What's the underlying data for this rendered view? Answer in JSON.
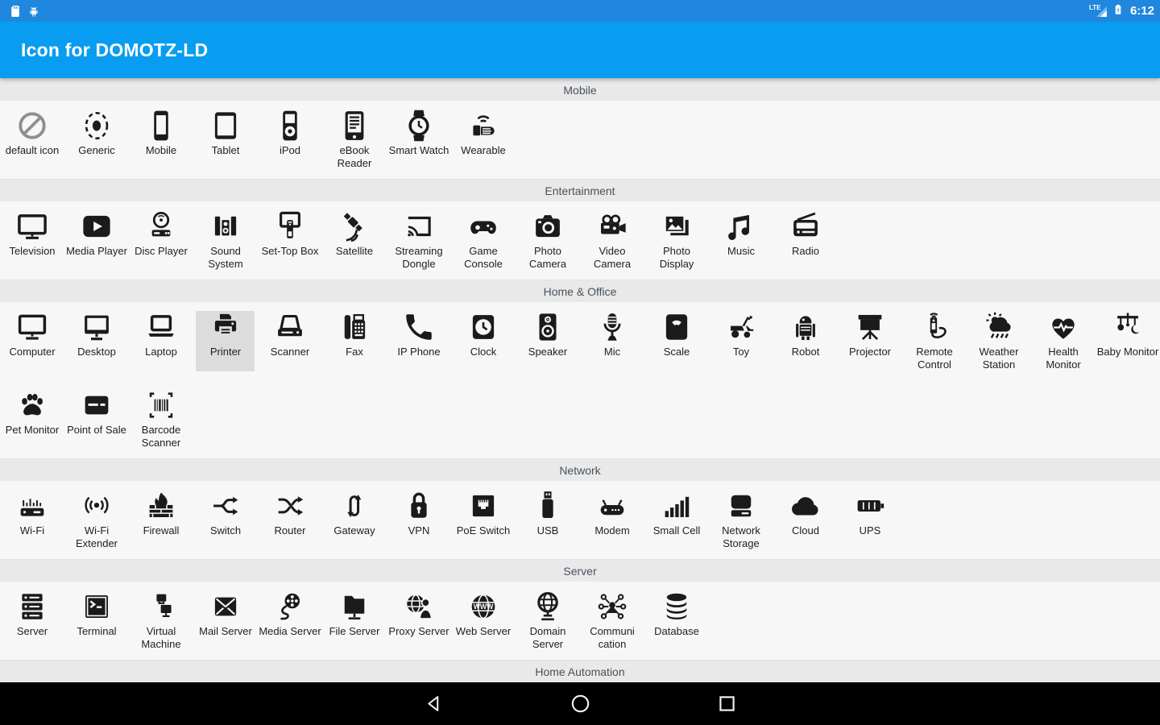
{
  "status_bar": {
    "time": "6:12",
    "network_label": "LTE",
    "left_icons": [
      "sd-card-icon",
      "android-icon"
    ],
    "right_icons": [
      "signal-icon",
      "battery-charging-icon"
    ]
  },
  "app_bar": {
    "title": "Icon for DOMOTZ-LD"
  },
  "colors": {
    "status_bar_bg": "#1f87dd",
    "app_bar_bg": "#089df0",
    "content_bg": "#f7f7f7",
    "section_header_bg": "#e9e9e9",
    "selected_cell_bg": "#dcdcdc",
    "nav_bar_bg": "#000000",
    "icon_color": "#1b1b1b"
  },
  "selection": {
    "section": "Home & Office",
    "label": "Printer"
  },
  "sections": [
    {
      "title": "Mobile",
      "items": [
        {
          "label": "default icon",
          "icon": "default",
          "muted": true
        },
        {
          "label": "Generic",
          "icon": "generic"
        },
        {
          "label": "Mobile",
          "icon": "mobile"
        },
        {
          "label": "Tablet",
          "icon": "tablet"
        },
        {
          "label": "iPod",
          "icon": "ipod"
        },
        {
          "label": "eBook Reader",
          "icon": "ebook-reader"
        },
        {
          "label": "Smart Watch",
          "icon": "smart-watch"
        },
        {
          "label": "Wearable",
          "icon": "wearable"
        }
      ]
    },
    {
      "title": "Entertainment",
      "items": [
        {
          "label": "Television",
          "icon": "television"
        },
        {
          "label": "Media Player",
          "icon": "media-player"
        },
        {
          "label": "Disc Player",
          "icon": "disc-player"
        },
        {
          "label": "Sound System",
          "icon": "sound-system"
        },
        {
          "label": "Set-Top Box",
          "icon": "set-top-box"
        },
        {
          "label": "Satellite",
          "icon": "satellite"
        },
        {
          "label": "Streaming Dongle",
          "icon": "streaming-dongle"
        },
        {
          "label": "Game Console",
          "icon": "game-console"
        },
        {
          "label": "Photo Camera",
          "icon": "photo-camera"
        },
        {
          "label": "Video Camera",
          "icon": "video-camera"
        },
        {
          "label": "Photo Display",
          "icon": "photo-display"
        },
        {
          "label": "Music",
          "icon": "music"
        },
        {
          "label": "Radio",
          "icon": "radio"
        }
      ]
    },
    {
      "title": "Home & Office",
      "items": [
        {
          "label": "Computer",
          "icon": "computer"
        },
        {
          "label": "Desktop",
          "icon": "desktop"
        },
        {
          "label": "Laptop",
          "icon": "laptop"
        },
        {
          "label": "Printer",
          "icon": "printer",
          "selected": true
        },
        {
          "label": "Scanner",
          "icon": "scanner"
        },
        {
          "label": "Fax",
          "icon": "fax"
        },
        {
          "label": "IP Phone",
          "icon": "ip-phone"
        },
        {
          "label": "Clock",
          "icon": "clock"
        },
        {
          "label": "Speaker",
          "icon": "speaker"
        },
        {
          "label": "Mic",
          "icon": "mic"
        },
        {
          "label": "Scale",
          "icon": "scale"
        },
        {
          "label": "Toy",
          "icon": "toy"
        },
        {
          "label": "Robot",
          "icon": "robot"
        },
        {
          "label": "Projector",
          "icon": "projector"
        },
        {
          "label": "Remote Control",
          "icon": "remote-control"
        },
        {
          "label": "Weather Station",
          "icon": "weather-station"
        },
        {
          "label": "Health Monitor",
          "icon": "health-monitor"
        },
        {
          "label": "Baby Monitor",
          "icon": "baby-monitor"
        },
        {
          "label": "Pet Monitor",
          "icon": "pet-monitor"
        },
        {
          "label": "Point of Sale",
          "icon": "point-of-sale"
        },
        {
          "label": "Barcode Scanner",
          "icon": "barcode-scanner"
        }
      ]
    },
    {
      "title": "Network",
      "items": [
        {
          "label": "Wi-Fi",
          "icon": "wifi"
        },
        {
          "label": "Wi-Fi Extender",
          "icon": "wifi-extender"
        },
        {
          "label": "Firewall",
          "icon": "firewall"
        },
        {
          "label": "Switch",
          "icon": "switch"
        },
        {
          "label": "Router",
          "icon": "router"
        },
        {
          "label": "Gateway",
          "icon": "gateway"
        },
        {
          "label": "VPN",
          "icon": "vpn"
        },
        {
          "label": "PoE Switch",
          "icon": "poe-switch"
        },
        {
          "label": "USB",
          "icon": "usb"
        },
        {
          "label": "Modem",
          "icon": "modem"
        },
        {
          "label": "Small Cell",
          "icon": "small-cell"
        },
        {
          "label": "Network Storage",
          "icon": "network-storage"
        },
        {
          "label": "Cloud",
          "icon": "cloud"
        },
        {
          "label": "UPS",
          "icon": "ups"
        }
      ]
    },
    {
      "title": "Server",
      "items": [
        {
          "label": "Server",
          "icon": "server"
        },
        {
          "label": "Terminal",
          "icon": "terminal"
        },
        {
          "label": "Virtual Machine",
          "icon": "virtual-machine"
        },
        {
          "label": "Mail Server",
          "icon": "mail-server"
        },
        {
          "label": "Media Server",
          "icon": "media-server"
        },
        {
          "label": "File Server",
          "icon": "file-server"
        },
        {
          "label": "Proxy Server",
          "icon": "proxy-server"
        },
        {
          "label": "Web Server",
          "icon": "web-server"
        },
        {
          "label": "Domain Server",
          "icon": "domain-server"
        },
        {
          "label": "Communi cation",
          "icon": "communication"
        },
        {
          "label": "Database",
          "icon": "database"
        }
      ]
    },
    {
      "title": "Home Automation",
      "items": []
    }
  ],
  "nav_bar": {
    "icons": [
      "back",
      "home",
      "recents"
    ]
  }
}
